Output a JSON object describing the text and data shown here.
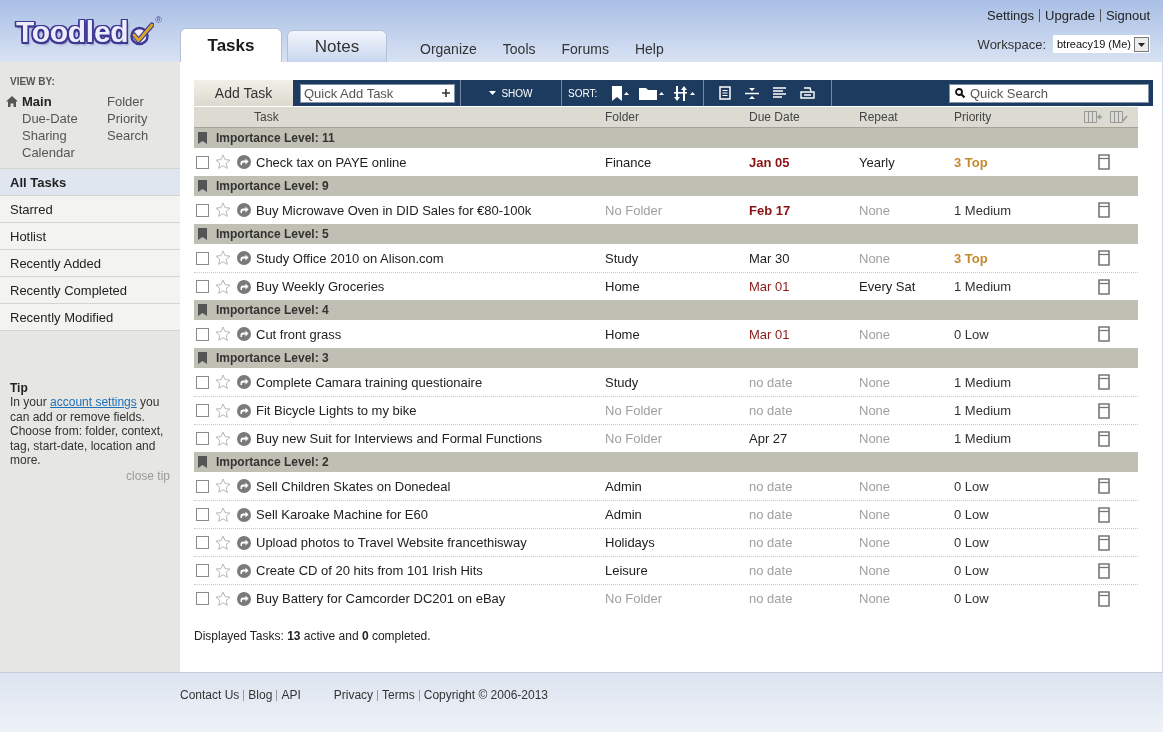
{
  "header": {
    "logo": {
      "text": "Toodled",
      "registered": "®"
    },
    "tabs": [
      {
        "label": "Tasks",
        "selected": true
      },
      {
        "label": "Notes",
        "selected": false
      }
    ],
    "nav": [
      "Organize",
      "Tools",
      "Forums",
      "Help"
    ],
    "account_links": [
      "Settings",
      "Upgrade",
      "Signout"
    ],
    "workspace": {
      "label": "Workspace:",
      "value": "btreacy19 (Me)"
    }
  },
  "sidebar": {
    "view_by": {
      "title": "VIEW BY:",
      "columns": [
        [
          {
            "label": "Main",
            "selected": true
          },
          {
            "label": "Due-Date",
            "selected": false
          },
          {
            "label": "Sharing",
            "selected": false
          },
          {
            "label": "Calendar",
            "selected": false
          }
        ],
        [
          {
            "label": "Folder",
            "selected": false
          },
          {
            "label": "Priority",
            "selected": false
          },
          {
            "label": "Search",
            "selected": false
          }
        ]
      ]
    },
    "lists": [
      {
        "label": "All Tasks",
        "selected": true
      },
      {
        "label": "Starred",
        "selected": false
      },
      {
        "label": "Hotlist",
        "selected": false
      },
      {
        "label": "Recently Added",
        "selected": false
      },
      {
        "label": "Recently Completed",
        "selected": false
      },
      {
        "label": "Recently Modified",
        "selected": false
      }
    ],
    "tip": {
      "title": "Tip",
      "text_before": "In your",
      "link": "account settings",
      "text_after": "you can add or remove fields. Choose from: folder, context, tag, start-date, location and more.",
      "close_label": "close tip"
    }
  },
  "toolbar": {
    "add_task": "Add Task",
    "quick_add_placeholder": "Quick Add Task",
    "show_label": "SHOW",
    "sort_label": "SORT:",
    "search_placeholder": "Quick Search"
  },
  "table": {
    "columns": [
      "Task",
      "Folder",
      "Due Date",
      "Repeat",
      "Priority"
    ],
    "groups": [
      {
        "title": "Importance Level: 11",
        "tasks": [
          {
            "title": "Check tax on PAYE online",
            "completed": false,
            "starred": false,
            "folder": {
              "text": "Finance",
              "muted": false
            },
            "due_date": {
              "text": "Jan 05",
              "kind": "overdue"
            },
            "repeat": {
              "text": "Yearly",
              "muted": false
            },
            "priority": {
              "text": "3 Top",
              "kind": "top"
            }
          }
        ]
      },
      {
        "title": "Importance Level: 9",
        "tasks": [
          {
            "title": "Buy Microwave Oven in DID Sales for €80-100k",
            "completed": false,
            "starred": false,
            "folder": {
              "text": "No Folder",
              "muted": true
            },
            "due_date": {
              "text": "Feb 17",
              "kind": "overdue"
            },
            "repeat": {
              "text": "None",
              "muted": true
            },
            "priority": {
              "text": "1 Medium",
              "kind": "medium"
            }
          }
        ]
      },
      {
        "title": "Importance Level: 5",
        "tasks": [
          {
            "title": "Study Office 2010 on Alison.com",
            "completed": false,
            "starred": false,
            "folder": {
              "text": "Study",
              "muted": false
            },
            "due_date": {
              "text": "Mar 30",
              "kind": "normal"
            },
            "repeat": {
              "text": "None",
              "muted": true
            },
            "priority": {
              "text": "3 Top",
              "kind": "top"
            }
          },
          {
            "title": "Buy Weekly Groceries",
            "completed": false,
            "starred": false,
            "folder": {
              "text": "Home",
              "muted": false
            },
            "due_date": {
              "text": "Mar 01",
              "kind": "soon"
            },
            "repeat": {
              "text": "Every Sat",
              "muted": false
            },
            "priority": {
              "text": "1 Medium",
              "kind": "medium"
            }
          }
        ]
      },
      {
        "title": "Importance Level: 4",
        "tasks": [
          {
            "title": "Cut front grass",
            "completed": false,
            "starred": false,
            "folder": {
              "text": "Home",
              "muted": false
            },
            "due_date": {
              "text": "Mar 01",
              "kind": "soon"
            },
            "repeat": {
              "text": "None",
              "muted": true
            },
            "priority": {
              "text": "0 Low",
              "kind": "low"
            }
          }
        ]
      },
      {
        "title": "Importance Level: 3",
        "tasks": [
          {
            "title": "Complete Camara training questionaire",
            "completed": false,
            "starred": false,
            "folder": {
              "text": "Study",
              "muted": false
            },
            "due_date": {
              "text": "no date",
              "kind": "none"
            },
            "repeat": {
              "text": "None",
              "muted": true
            },
            "priority": {
              "text": "1 Medium",
              "kind": "medium"
            }
          },
          {
            "title": "Fit Bicycle Lights to my bike",
            "completed": false,
            "starred": false,
            "folder": {
              "text": "No Folder",
              "muted": true
            },
            "due_date": {
              "text": "no date",
              "kind": "none"
            },
            "repeat": {
              "text": "None",
              "muted": true
            },
            "priority": {
              "text": "1 Medium",
              "kind": "medium"
            }
          },
          {
            "title": "Buy new Suit for Interviews and Formal Functions",
            "completed": false,
            "starred": false,
            "folder": {
              "text": "No Folder",
              "muted": true
            },
            "due_date": {
              "text": "Apr 27",
              "kind": "normal"
            },
            "repeat": {
              "text": "None",
              "muted": true
            },
            "priority": {
              "text": "1 Medium",
              "kind": "medium"
            }
          }
        ]
      },
      {
        "title": "Importance Level: 2",
        "tasks": [
          {
            "title": "Sell Children Skates on Donedeal",
            "completed": false,
            "starred": false,
            "folder": {
              "text": "Admin",
              "muted": false
            },
            "due_date": {
              "text": "no date",
              "kind": "none"
            },
            "repeat": {
              "text": "None",
              "muted": true
            },
            "priority": {
              "text": "0 Low",
              "kind": "low"
            }
          },
          {
            "title": "Sell Karoake Machine for E60",
            "completed": false,
            "starred": false,
            "folder": {
              "text": "Admin",
              "muted": false
            },
            "due_date": {
              "text": "no date",
              "kind": "none"
            },
            "repeat": {
              "text": "None",
              "muted": true
            },
            "priority": {
              "text": "0 Low",
              "kind": "low"
            }
          },
          {
            "title": "Upload photos to Travel Website francethisway",
            "completed": false,
            "starred": false,
            "folder": {
              "text": "Holidays",
              "muted": false
            },
            "due_date": {
              "text": "no date",
              "kind": "none"
            },
            "repeat": {
              "text": "None",
              "muted": true
            },
            "priority": {
              "text": "0 Low",
              "kind": "low"
            }
          },
          {
            "title": "Create CD of 20 hits from 101 Irish Hits",
            "completed": false,
            "starred": false,
            "folder": {
              "text": "Leisure",
              "muted": false
            },
            "due_date": {
              "text": "no date",
              "kind": "none"
            },
            "repeat": {
              "text": "None",
              "muted": true
            },
            "priority": {
              "text": "0 Low",
              "kind": "low"
            }
          },
          {
            "title": "Buy Battery for Camcorder DC201 on eBay",
            "completed": false,
            "starred": false,
            "folder": {
              "text": "No Folder",
              "muted": true
            },
            "due_date": {
              "text": "no date",
              "kind": "none"
            },
            "repeat": {
              "text": "None",
              "muted": true
            },
            "priority": {
              "text": "0 Low",
              "kind": "low"
            }
          }
        ]
      }
    ],
    "summary": "Displayed Tasks: **13** active and **0** completed."
  },
  "footer": {
    "links_left": [
      "Contact Us",
      "Blog",
      "API"
    ],
    "links_right": [
      "Privacy",
      "Terms"
    ],
    "copyright": "Copyright © 2006-2013"
  }
}
